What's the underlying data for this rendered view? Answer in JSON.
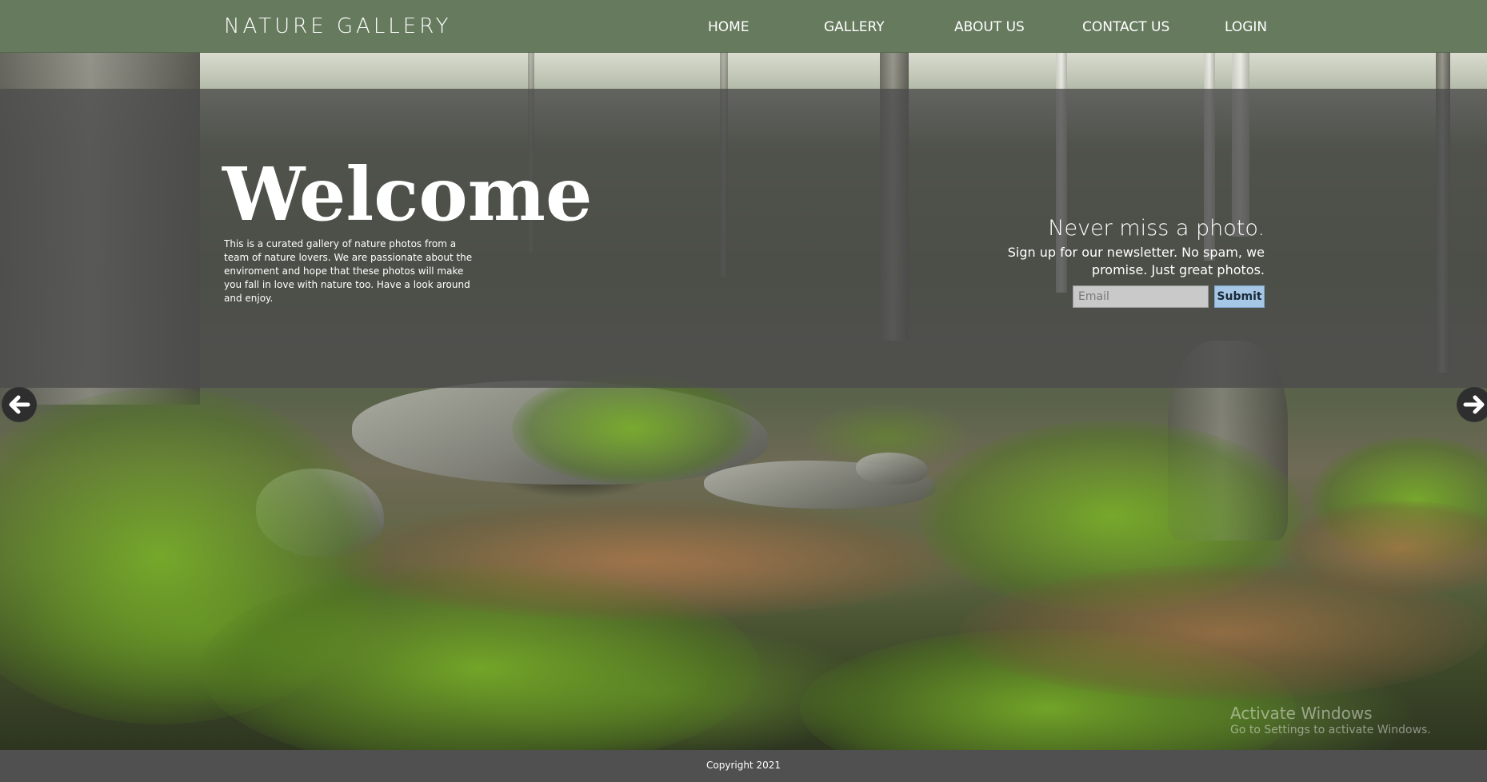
{
  "header": {
    "brand": "NATURE GALLERY",
    "nav": [
      {
        "label": "HOME"
      },
      {
        "label": "GALLERY"
      },
      {
        "label": "ABOUT US"
      },
      {
        "label": "CONTACT US"
      },
      {
        "label": "LOGIN"
      }
    ]
  },
  "hero": {
    "title": "Welcome",
    "description": "This is a curated gallery of nature photos from a team of nature lovers. We are passionate about the enviroment and hope that these photos will make you fall in love with nature too. Have a look around and enjoy."
  },
  "newsletter": {
    "heading": "Never miss a photo.",
    "text": "Sign up for our newsletter. No spam, we promise. Just great photos.",
    "email_placeholder": "Email",
    "email_value": "",
    "submit_label": "Submit"
  },
  "carousel": {
    "prev_icon": "arrow-left-icon",
    "next_icon": "arrow-right-icon"
  },
  "watermark": {
    "title": "Activate Windows",
    "subtitle": "Go to Settings to activate Windows."
  },
  "footer": {
    "copyright": "Copyright 2021"
  },
  "colors": {
    "navbar": "#667a5e",
    "overlay": "#4b4b4b",
    "footer": "#505050",
    "submit_button": "#a6c8e6"
  }
}
